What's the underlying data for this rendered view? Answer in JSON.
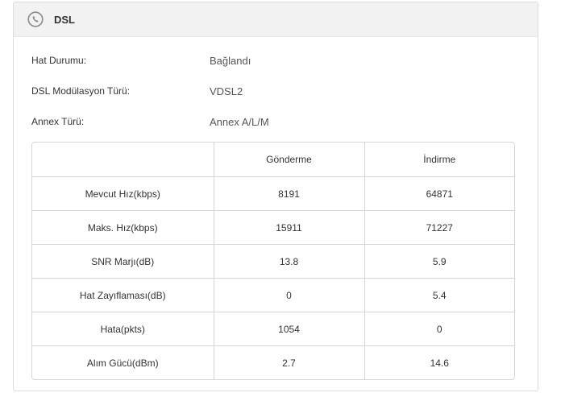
{
  "panel": {
    "title": "DSL",
    "icon": "phone-icon"
  },
  "info": [
    {
      "label": "Hat Durumu:",
      "value": "Bağlandı"
    },
    {
      "label": "DSL Modülasyon Türü:",
      "value": "VDSL2"
    },
    {
      "label": "Annex Türü:",
      "value": "Annex A/L/M"
    }
  ],
  "table": {
    "headers": [
      "",
      "Gönderme",
      "İndirme"
    ],
    "rows": [
      {
        "label": "Mevcut Hız(kbps)",
        "upload": "8191",
        "download": "64871"
      },
      {
        "label": "Maks. Hız(kbps)",
        "upload": "15911",
        "download": "71227"
      },
      {
        "label": "SNR Marjı(dB)",
        "upload": "13.8",
        "download": "5.9"
      },
      {
        "label": "Hat Zayıflaması(dB)",
        "upload": "0",
        "download": "5.4"
      },
      {
        "label": "Hata(pkts)",
        "upload": "1054",
        "download": "0"
      },
      {
        "label": "Alım Gücü(dBm)",
        "upload": "2.7",
        "download": "14.6"
      }
    ]
  }
}
